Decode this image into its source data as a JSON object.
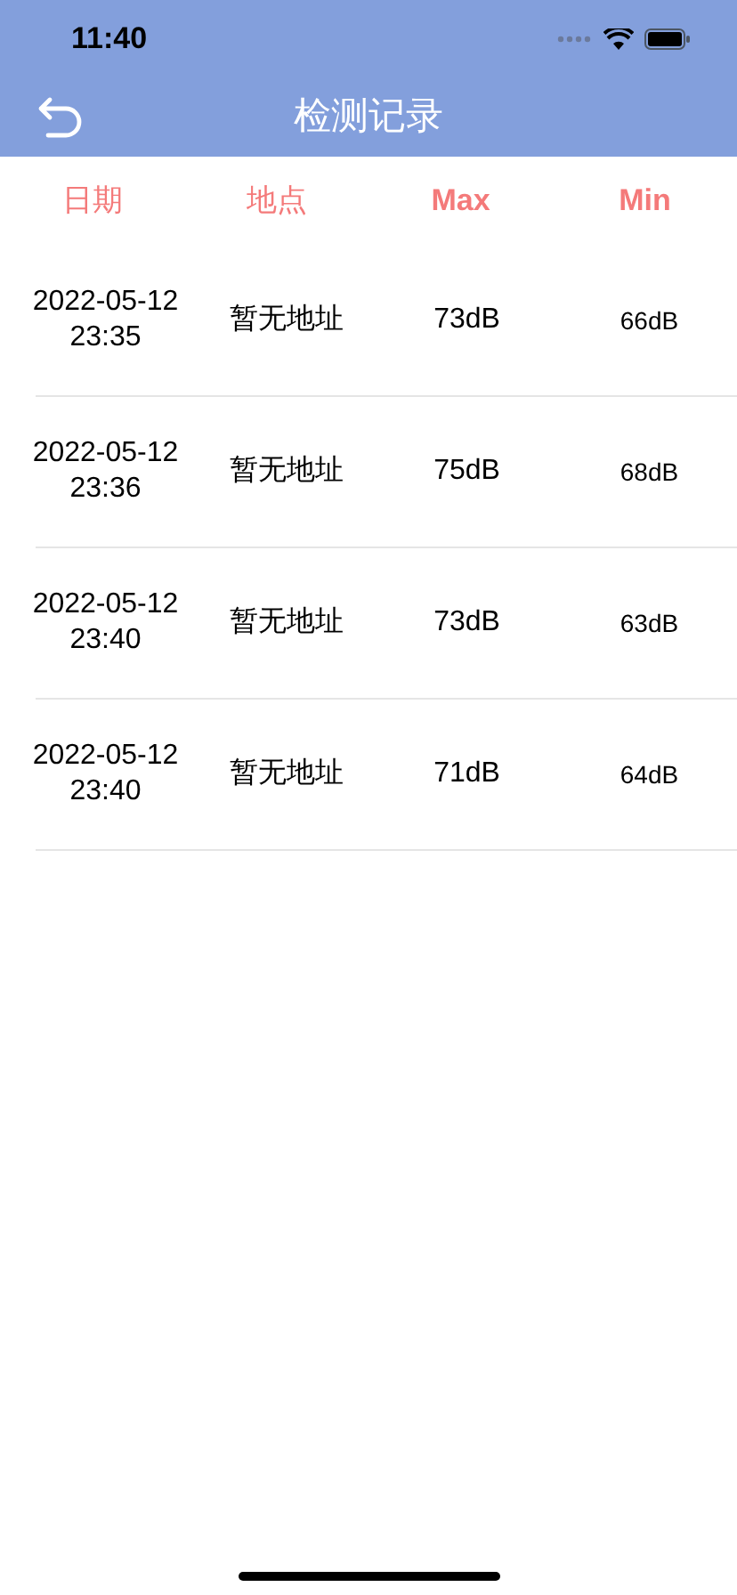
{
  "status_bar": {
    "time": "11:40"
  },
  "nav": {
    "title": "检测记录"
  },
  "table": {
    "columns": [
      "日期",
      "地点",
      "Max",
      "Min"
    ],
    "rows": [
      {
        "date": "2022-05-12 23:35",
        "location": "暂无地址",
        "max": "73dB",
        "min": "66dB"
      },
      {
        "date": "2022-05-12 23:36",
        "location": "暂无地址",
        "max": "75dB",
        "min": "68dB"
      },
      {
        "date": "2022-05-12 23:40",
        "location": "暂无地址",
        "max": "73dB",
        "min": "63dB"
      },
      {
        "date": "2022-05-12 23:40",
        "location": "暂无地址",
        "max": "71dB",
        "min": "64dB"
      }
    ]
  }
}
